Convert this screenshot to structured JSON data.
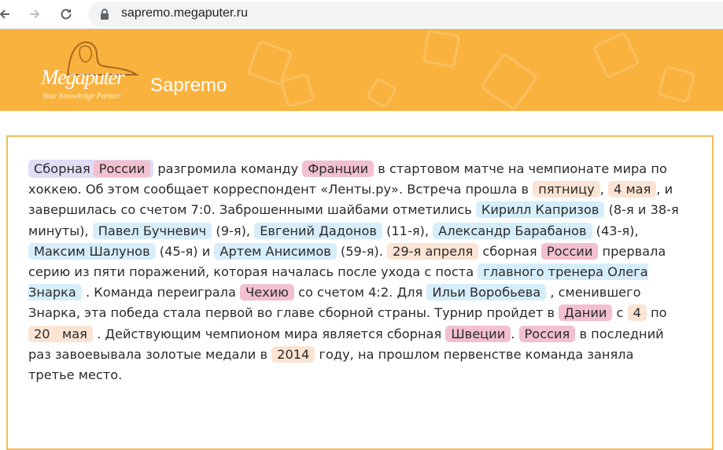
{
  "browser": {
    "url": "sapremo.megaputer.ru",
    "back_icon": "arrow-left",
    "forward_icon": "arrow-right",
    "reload_icon": "reload",
    "lock_icon": "lock"
  },
  "header": {
    "logo_text": "Megaputer",
    "logo_tagline": "Your Knowledge Partner",
    "title": "Sapremo",
    "background_color": "#f9b23e"
  },
  "colors": {
    "organization": "#e2dcf6",
    "location": "#f2c0cf",
    "person": "#d6eefa",
    "date": "#fbe4d3",
    "panel_border": "#efbd5a"
  },
  "article": {
    "org1_word": "Сборная",
    "loc_russia_1": "России",
    "t1": "разгромила команду",
    "loc_france": "Франции",
    "t2": "в стартовом матче на чемпионате мира по хоккею. Об этом сообщает корреспондент «Ленты.ру». Встреча прошла в",
    "date_friday": "пятницу",
    "t3": ",",
    "date_may4": "4 мая",
    "t4": ", и завершилась со счетом 7:0. Заброшенными шайбами отметились",
    "per_kaprizov": "Кирилл Капризов",
    "t5": "(8-я и 38-я минуты),",
    "per_buchnevich": "Павел Бучневич",
    "t6": "(9-я),",
    "per_dadonov": "Евгений Дадонов",
    "t7": "(11-я),",
    "per_barabanov": "Александр Барабанов",
    "t8": "(43-я),",
    "per_shalunov": "Максим Шалунов",
    "t9": "(45-я) и",
    "per_anisimov": "Артем Анисимов",
    "t10": "(59-я).",
    "date_apr29": "29-я апреля",
    "t11": "сборная",
    "loc_russia_2": "России",
    "t12": "прервала серию из пяти поражений, которая началась после ухода с поста",
    "per_znarok": "главного тренера Олега Знарка",
    "t13": ". Команда переиграла",
    "loc_czech": "Чехию",
    "t14": "со счетом 4:2. Для",
    "per_vorobiev": "Ильи Воробьева",
    "t15": ", сменившего Знарка, эта победа стала первой во главе сборной страны. Турнир пройдет в",
    "loc_denmark": "Дании",
    "t16": "с",
    "date_4": "4",
    "t17": "по",
    "date_20_day": "20",
    "date_20_month": "мая",
    "t18": ". Действующим чемпионом мира является сборная",
    "loc_sweden": "Швеции",
    "t19": ".",
    "loc_russia_3": "Россия",
    "t20": "в последний раз завоевывала золотые медали в",
    "date_2014": "2014",
    "t21": "году, на прошлом первенстве команда заняла третье место."
  }
}
